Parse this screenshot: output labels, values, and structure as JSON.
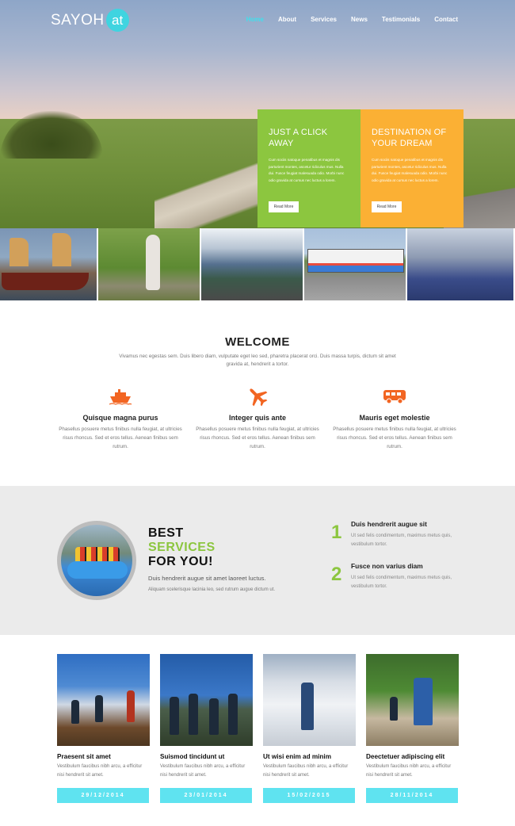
{
  "brand": {
    "name": "SAYOH",
    "badge": "at"
  },
  "nav": [
    "Home",
    "About",
    "Services",
    "News",
    "Testimonials",
    "Contact"
  ],
  "promos": [
    {
      "title": "JUST A CLICK AWAY",
      "body": "Cum sociis natoque penatibus et magnis dis parturient montes, ascetur ridiculus mus. Nulla dui. Fusce feugiat malesuada odio. Morbi nunc odio gravida at cursus nec luctus a lorem.",
      "button": "Read More",
      "color": "#8cc63f"
    },
    {
      "title": "DESTINATION OF YOUR DREAM",
      "body": "Cum sociis natoque penatibus et magnis dis parturient montes, ascetur ridiculus mus. Nulla dui. Fusce feugiat malesuada odio. Morbi nunc odio gravida at cursus nec luctus a lorem.",
      "button": "Read More",
      "color": "#fbb034"
    }
  ],
  "welcome": {
    "title": "WELCOME",
    "text": "Vivamus nec egestas sem. Duis libero diam, vulputate eget leo sed, pharetra placerat orci. Duis massa turpis, dictum sit amet gravida at, hendrerit a tortor."
  },
  "features": [
    {
      "icon": "ship-icon",
      "title": "Quisque magna purus",
      "text": "Phasellus posuere metus finibus nulla feugiat, at ultricies risus rhoncus. Sed et eros tellus. Aenean finibus sem rutrum."
    },
    {
      "icon": "airplane-icon",
      "title": "Integer quis ante",
      "text": "Phasellus posuere metus finibus nulla feugiat, at ultricies risus rhoncus. Sed et eros tellus. Aenean finibus sem rutrum."
    },
    {
      "icon": "bus-icon",
      "title": "Mauris eget molestie",
      "text": "Phasellus posuere metus finibus nulla feugiat, at ultricies risus rhoncus. Sed et eros tellus. Aenean finibus sem rutrum."
    }
  ],
  "services": {
    "line1": "BEST",
    "line2": "SERVICES",
    "line3": "FOR YOU!",
    "subtitle": "Duis hendrerit augue sit amet laoreet luctus.",
    "desc": "Aliquam scelerisque lacinia leo, sed rutrum augue dictum ut.",
    "steps": [
      {
        "num": "1",
        "title": "Duis hendrerit augue sit",
        "text": "Ut sed felis condimentum, maximus metus quis, vestibulum tortor."
      },
      {
        "num": "2",
        "title": "Fusce non varius diam",
        "text": "Ut sed felis condimentum, maximus metus quis, vestibulum tortor."
      }
    ]
  },
  "posts": [
    {
      "title": "Praesent sit amet",
      "text": "Vestibulum faucibus nibh arcu, a efficitur nisi hendrerit sit amet.",
      "date": "29/12/2014"
    },
    {
      "title": "Suismod tincidunt ut",
      "text": "Vestibulum faucibus nibh arcu, a efficitur nisi hendrerit sit amet.",
      "date": "23/01/2014"
    },
    {
      "title": "Ut wisi enim ad minim",
      "text": "Vestibulum faucibus nibh arcu, a efficitur nisi hendrerit sit amet.",
      "date": "15/02/2015"
    },
    {
      "title": "Deectetuer adipiscing elit",
      "text": "Vestibulum faucibus nibh arcu, a efficitur nisi hendrerit sit amet.",
      "date": "28/11/2014"
    }
  ],
  "colors": {
    "accent": "#3fd4e0",
    "green": "#8cc63f",
    "orange": "#fbb034",
    "icon": "#f26522",
    "date_bar": "#5fe3f0"
  }
}
